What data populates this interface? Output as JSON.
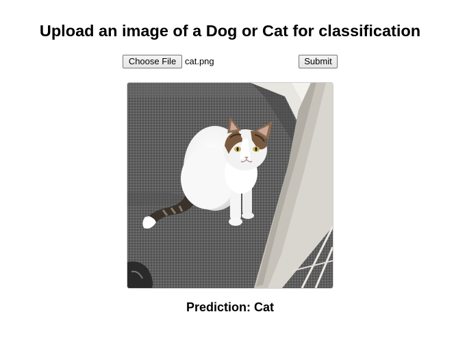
{
  "header": {
    "title": "Upload an image of a Dog or Cat for classification"
  },
  "upload_form": {
    "choose_file_label": "Choose File",
    "selected_file": "cat.png",
    "submit_label": "Submit"
  },
  "preview": {
    "image_subject": "white-and-tabby-cat-on-carpeted-stairs"
  },
  "result": {
    "prediction_text": "Prediction: Cat"
  }
}
